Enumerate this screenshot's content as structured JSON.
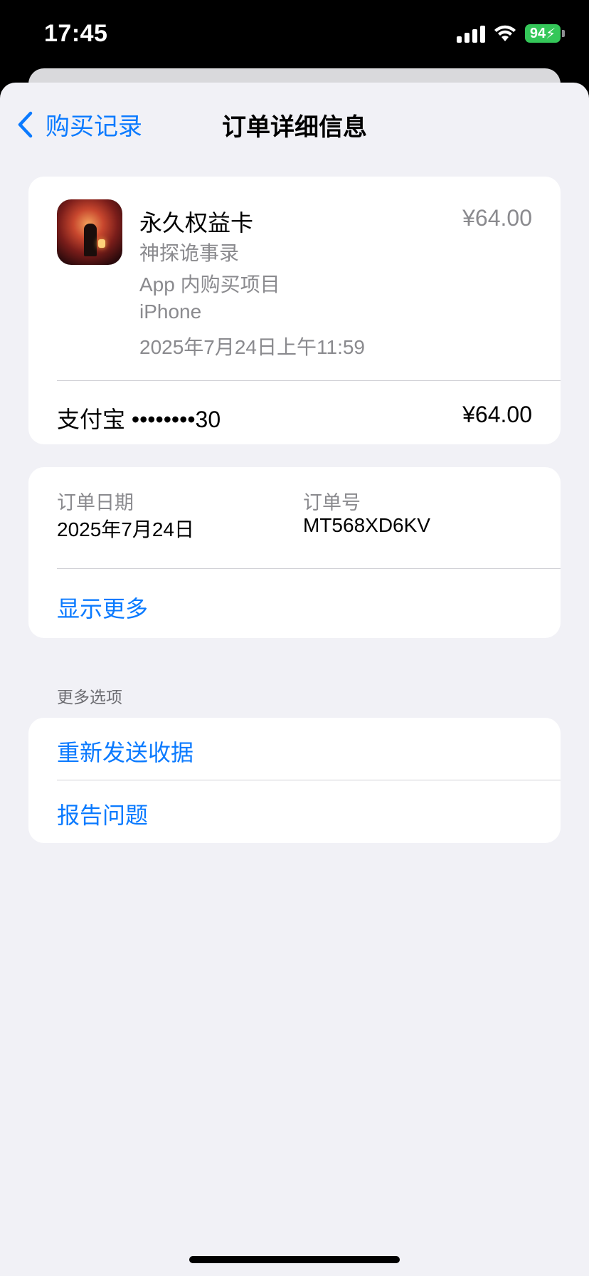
{
  "status": {
    "time": "17:45",
    "battery": "94"
  },
  "nav": {
    "back_label": "购买记录",
    "title": "订单详细信息"
  },
  "item": {
    "name": "永久权益卡",
    "price": "¥64.00",
    "app_name": "神探诡事录",
    "type": "App 内购买项目",
    "device": "iPhone",
    "datetime": "2025年7月24日上午11:59"
  },
  "payment": {
    "method": "支付宝 ••••••••30",
    "amount": "¥64.00"
  },
  "order": {
    "date_label": "订单日期",
    "date_value": "2025年7月24日",
    "id_label": "订单号",
    "id_value": "MT568XD6KV",
    "show_more": "显示更多"
  },
  "more_options": {
    "header": "更多选项",
    "resend_receipt": "重新发送收据",
    "report_problem": "报告问题"
  },
  "colors": {
    "accent": "#0a7aff",
    "battery": "#34c759"
  }
}
